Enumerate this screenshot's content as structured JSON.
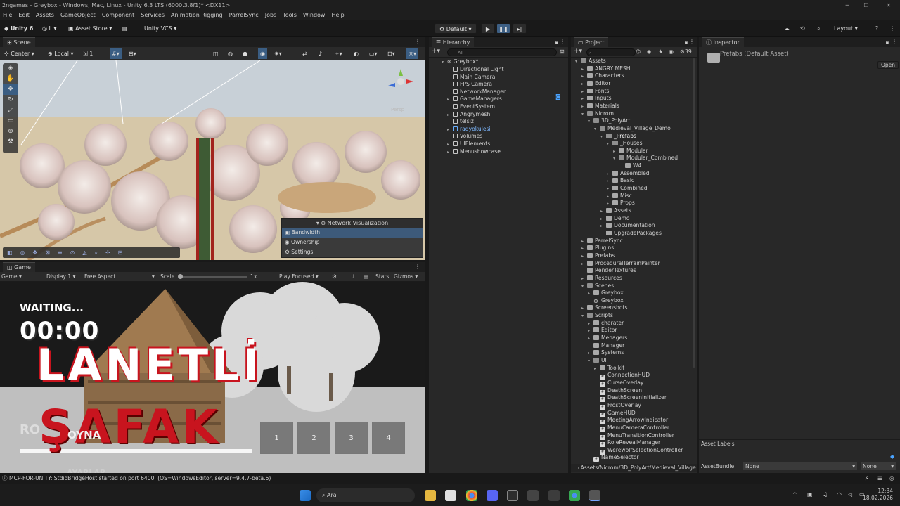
{
  "window": {
    "title": "2ngames - Greybox - Windows, Mac, Linux - Unity 6.3 LTS (6000.3.8f1)* <DX11>",
    "minimize": "─",
    "maximize": "☐",
    "close": "✕"
  },
  "menus": [
    "File",
    "Edit",
    "Assets",
    "GameObject",
    "Component",
    "Services",
    "Animation Rigging",
    "ParrelSync",
    "Jobs",
    "Tools",
    "Window",
    "Help"
  ],
  "toolbar": {
    "unity": "Unity 6",
    "account": "L",
    "asset_store": "Asset Store",
    "vcs": "Unity VCS",
    "default": "Default",
    "layout": "Layout"
  },
  "scene": {
    "tab": "Scene",
    "pivot": "Center",
    "space": "Local",
    "snap": "1",
    "persp": "Persp",
    "overlay": {
      "title": "Network Visualization",
      "items": [
        "Bandwidth",
        "Ownership",
        "Settings"
      ]
    }
  },
  "game": {
    "tab": "Game",
    "mode": "Game",
    "display": "Display 1",
    "aspect": "Free Aspect",
    "scale_label": "Scale",
    "scale_value": "1x",
    "play": "Play Focused",
    "stats": "Stats",
    "gizmos": "Gizmos",
    "waiting": "WAITING...",
    "timer": "00:00",
    "title_line1": "LANETLİ",
    "title_line2": "ŞAFAK",
    "overlay_text": "RO",
    "oyna": "OYNA",
    "slots": [
      "1",
      "2",
      "3",
      "4"
    ],
    "bottom": "AYARLAR"
  },
  "hierarchy": {
    "tab": "Hierarchy",
    "search": "All",
    "root": "Greybox*",
    "items": [
      {
        "label": "Directional Light",
        "exp": false
      },
      {
        "label": "Main Camera",
        "exp": false
      },
      {
        "label": "FPS Camera",
        "exp": false
      },
      {
        "label": "NetworkManager",
        "exp": false
      },
      {
        "label": "GameManagers",
        "exp": true
      },
      {
        "label": "EventSystem",
        "exp": false
      },
      {
        "label": "Angrymesh",
        "exp": true
      },
      {
        "label": "telsiz",
        "exp": false
      },
      {
        "label": "radyokulesi",
        "exp": true,
        "blue": true
      },
      {
        "label": "Volumes",
        "exp": false
      },
      {
        "label": "UIElements",
        "exp": true
      },
      {
        "label": "Menushowcase",
        "exp": true
      }
    ]
  },
  "project": {
    "tab": "Project",
    "count": "39",
    "root": "Assets",
    "tree": [
      {
        "d": 1,
        "t": "ANGRY MESH",
        "k": "f",
        "a": "▸"
      },
      {
        "d": 1,
        "t": "Characters",
        "k": "f",
        "a": "▸"
      },
      {
        "d": 1,
        "t": "Editor",
        "k": "f",
        "a": "▸"
      },
      {
        "d": 1,
        "t": "Fonts",
        "k": "f",
        "a": "▸"
      },
      {
        "d": 1,
        "t": "Inputs",
        "k": "f",
        "a": "▸"
      },
      {
        "d": 1,
        "t": "Materials",
        "k": "f",
        "a": "▸"
      },
      {
        "d": 1,
        "t": "Nicrom",
        "k": "o",
        "a": "▾"
      },
      {
        "d": 2,
        "t": "3D_PolyArt",
        "k": "o",
        "a": "▾"
      },
      {
        "d": 3,
        "t": "Medieval_Village_Demo",
        "k": "o",
        "a": "▾"
      },
      {
        "d": 4,
        "t": "_Prefabs",
        "k": "o",
        "a": "▾",
        "sel": true
      },
      {
        "d": 5,
        "t": "_Houses",
        "k": "o",
        "a": "▾"
      },
      {
        "d": 6,
        "t": "Modular",
        "k": "f",
        "a": "▸"
      },
      {
        "d": 6,
        "t": "Modular_Combined",
        "k": "o",
        "a": "▾"
      },
      {
        "d": 7,
        "t": "W4",
        "k": "f",
        "a": ""
      },
      {
        "d": 5,
        "t": "Assembled",
        "k": "f",
        "a": "▸"
      },
      {
        "d": 5,
        "t": "Basic",
        "k": "f",
        "a": "▸"
      },
      {
        "d": 5,
        "t": "Combined",
        "k": "f",
        "a": "▸"
      },
      {
        "d": 5,
        "t": "Misc",
        "k": "f",
        "a": "▸"
      },
      {
        "d": 5,
        "t": "Props",
        "k": "f",
        "a": "▸"
      },
      {
        "d": 4,
        "t": "Assets",
        "k": "f",
        "a": "▸"
      },
      {
        "d": 4,
        "t": "Demo",
        "k": "f",
        "a": "▸"
      },
      {
        "d": 4,
        "t": "Documentation",
        "k": "f",
        "a": "▸"
      },
      {
        "d": 4,
        "t": "UpgradePackages",
        "k": "f",
        "a": ""
      },
      {
        "d": 1,
        "t": "ParrelSync",
        "k": "f",
        "a": "▸"
      },
      {
        "d": 1,
        "t": "Plugins",
        "k": "f",
        "a": "▸"
      },
      {
        "d": 1,
        "t": "Prefabs",
        "k": "f",
        "a": "▸"
      },
      {
        "d": 1,
        "t": "ProceduralTerrainPainter",
        "k": "f",
        "a": "▸"
      },
      {
        "d": 1,
        "t": "RenderTextures",
        "k": "f",
        "a": ""
      },
      {
        "d": 1,
        "t": "Resources",
        "k": "f",
        "a": "▸"
      },
      {
        "d": 1,
        "t": "Scenes",
        "k": "o",
        "a": "▾"
      },
      {
        "d": 2,
        "t": "Greybox",
        "k": "f",
        "a": "▸"
      },
      {
        "d": 2,
        "t": "Greybox",
        "k": "u",
        "a": ""
      },
      {
        "d": 1,
        "t": "Screenshots",
        "k": "f",
        "a": "▸"
      },
      {
        "d": 1,
        "t": "Scripts",
        "k": "o",
        "a": "▾"
      },
      {
        "d": 2,
        "t": "charater",
        "k": "f",
        "a": "▸"
      },
      {
        "d": 2,
        "t": "Editor",
        "k": "f",
        "a": "▸"
      },
      {
        "d": 2,
        "t": "Menagers",
        "k": "f",
        "a": "▸"
      },
      {
        "d": 2,
        "t": "Manager",
        "k": "f",
        "a": ""
      },
      {
        "d": 2,
        "t": "Systems",
        "k": "f",
        "a": "▸"
      },
      {
        "d": 2,
        "t": "UI",
        "k": "o",
        "a": "▾"
      },
      {
        "d": 3,
        "t": "Toolkit",
        "k": "f",
        "a": "▸"
      },
      {
        "d": 3,
        "t": "ConnectionHUD",
        "k": "c",
        "a": ""
      },
      {
        "d": 3,
        "t": "CurseOverlay",
        "k": "c",
        "a": ""
      },
      {
        "d": 3,
        "t": "DeathScreen",
        "k": "c",
        "a": ""
      },
      {
        "d": 3,
        "t": "DeathScreenInitializer",
        "k": "c",
        "a": ""
      },
      {
        "d": 3,
        "t": "FrostOverlay",
        "k": "c",
        "a": ""
      },
      {
        "d": 3,
        "t": "GameHUD",
        "k": "c",
        "a": ""
      },
      {
        "d": 3,
        "t": "MeetingArrowIndicator",
        "k": "c",
        "a": ""
      },
      {
        "d": 3,
        "t": "MenuCameraController",
        "k": "c",
        "a": ""
      },
      {
        "d": 3,
        "t": "MenuTransitionController",
        "k": "c",
        "a": ""
      },
      {
        "d": 3,
        "t": "RoleRevealManager",
        "k": "c",
        "a": ""
      },
      {
        "d": 3,
        "t": "WerewolfSelectionController",
        "k": "c",
        "a": ""
      },
      {
        "d": 2,
        "t": "NameSelector",
        "k": "c",
        "a": ""
      }
    ],
    "path": "Assets/Nicrom/3D_PolyArt/Medieval_Village..."
  },
  "inspector": {
    "tab": "Inspector",
    "title": "Prefabs (Default Asset)",
    "open": "Open",
    "asset_labels": "Asset Labels",
    "asset_bundle": "AssetBundle",
    "none1": "None",
    "none2": "None"
  },
  "status": {
    "text": "MCP-FOR-UNITY: StdioBridgeHost started on port 6400. (OS=WindowsEditor, server=9.4.7-beta.6)"
  },
  "taskbar": {
    "search": "Ara",
    "time": "12:34",
    "date": "18.02.2026"
  },
  "colors": {
    "accent": "#2c5d87",
    "selected": "#2c5d87",
    "title_red": "#c8141e"
  }
}
